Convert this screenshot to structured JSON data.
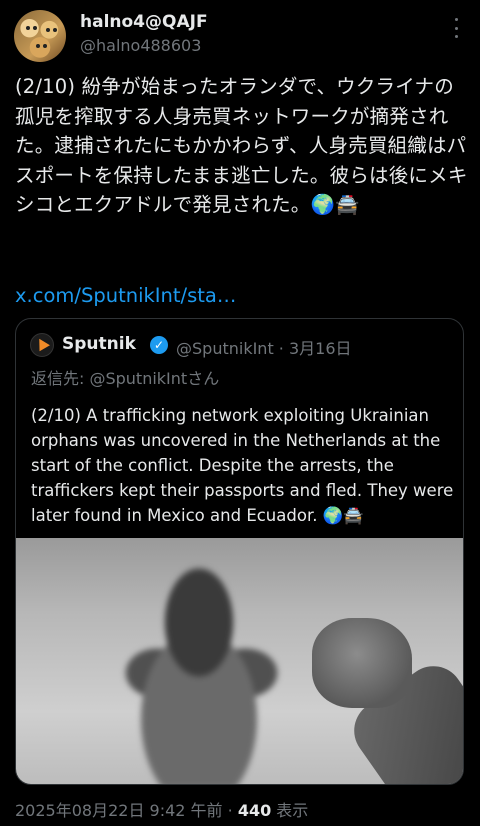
{
  "author": {
    "display_name": "halno4@QAJF",
    "handle": "@halno488603"
  },
  "tweet": {
    "text": "(2/10) 紛争が始まったオランダで、ウクライナの孤児を搾取する人身売買ネットワークが摘発された。逮捕されたにもかかわらず、人身売買組織はパスポートを保持したまま逃亡した。彼らは後にメキシコとエクアドルで発見された。🌍🚔",
    "link": "x.com/SputnikInt/sta…"
  },
  "quote": {
    "name": "Sputnik",
    "verified_mark": "✓",
    "handle_date": "@SputnikInt · 3月16日",
    "reply_to": "返信先: @SputnikIntさん",
    "text": "(2/10) A trafficking network exploiting Ukrainian orphans was uncovered in the Netherlands at the start of the conflict. Despite the arrests, the traffickers kept their passports and fled. They were later found in Mexico and Ecuador. 🌍🚔"
  },
  "meta": {
    "timestamp": "2025年08月22日 9:42 午前",
    "separator": " · ",
    "views": "440",
    "views_label": " 表示"
  }
}
